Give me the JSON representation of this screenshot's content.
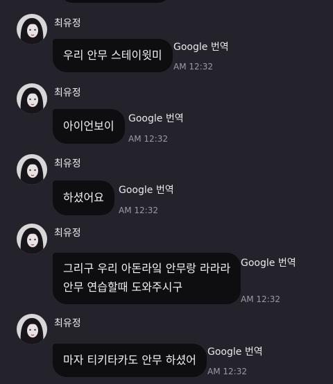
{
  "messages": [
    {
      "sender": "최유정",
      "lines": [
        "우리 안무 스테이윗미"
      ],
      "translate_label": "Google 번역",
      "time": "AM 12:32"
    },
    {
      "sender": "최유정",
      "lines": [
        "아이언보이"
      ],
      "translate_label": "Google 번역",
      "time": "AM 12:32"
    },
    {
      "sender": "최유정",
      "lines": [
        "하셨어요"
      ],
      "translate_label": "Google 번역",
      "time": "AM 12:32"
    },
    {
      "sender": "최유정",
      "lines": [
        "그리구 우리 아돈라잌 안무랑 라라라",
        "안무 연습할때 도와주시구"
      ],
      "translate_label": "Google 번역",
      "time": "AM 12:32"
    },
    {
      "sender": "최유정",
      "lines": [
        "마자 티키타카도 안무 하셨어"
      ],
      "translate_label": "Google 번역",
      "time": "AM 12:32"
    }
  ],
  "colors": {
    "background": "#24232b",
    "bubble": "#0e0e11",
    "text": "#f2f2f5",
    "timestamp": "#9d9aa8"
  },
  "icons": {
    "avatar": "profile-photo"
  }
}
